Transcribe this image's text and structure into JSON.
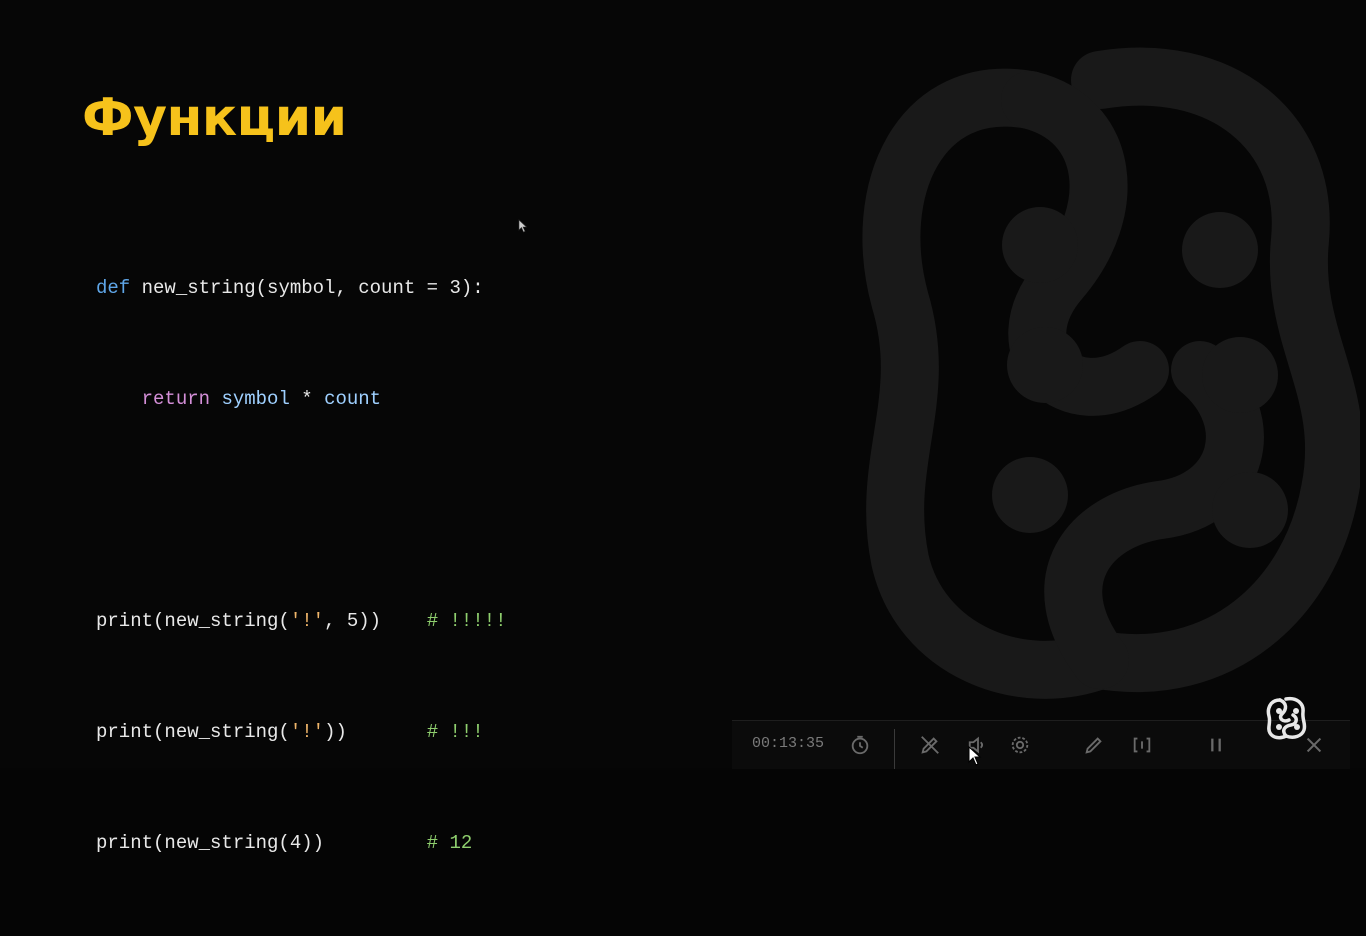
{
  "slide": {
    "title": "Функции",
    "code_tokens": {
      "def": "def",
      "fn_signature": " new_string(symbol, count = 3):",
      "indent": "    ",
      "return": "return",
      "return_space": " ",
      "symbol": "symbol",
      "times": " * ",
      "count": "count",
      "l3_print": "print(new_string(",
      "l3_str": "'!'",
      "l3_rest": ", 5))",
      "l3_pad": "    ",
      "l3_comment": "# !!!!!",
      "l4_print": "print(new_string(",
      "l4_str": "'!'",
      "l4_rest": "))",
      "l4_pad": "       ",
      "l4_comment": "# !!!",
      "l5_print": "print(new_string(4))",
      "l5_pad": "         ",
      "l5_comment": "# 12"
    }
  },
  "toolbar": {
    "timer": "00:13:35",
    "icons": [
      "timer-icon",
      "pen-off-icon",
      "volume-icon",
      "settings-icon",
      "pencil-icon",
      "slide-number-icon",
      "pause-icon",
      "exit-icon"
    ]
  },
  "colors": {
    "title": "#f6c21b",
    "background": "#060606",
    "keyword_def": "#5fa6e8",
    "keyword_return": "#d48fd8",
    "string": "#efb56a",
    "comment": "#8fcf6e"
  }
}
